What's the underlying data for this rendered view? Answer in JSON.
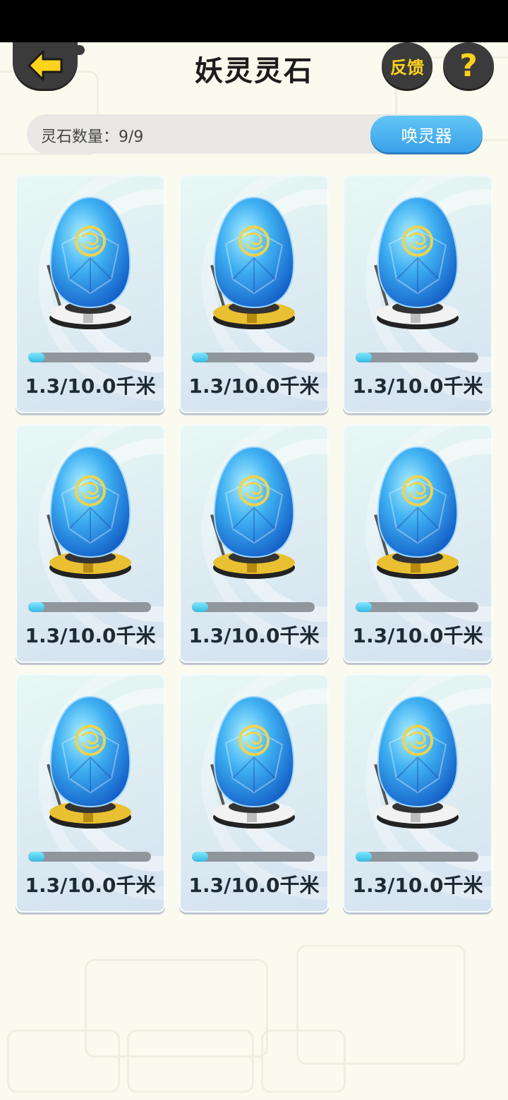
{
  "header": {
    "title": "妖灵灵石",
    "feedback_label": "反馈",
    "help_label": "?"
  },
  "summary": {
    "count_text": "灵石数量：9/9",
    "summon_label": "唤灵器"
  },
  "cards": [
    {
      "distance": "1.3/10.0千米",
      "progress": 0.13,
      "base": "white"
    },
    {
      "distance": "1.3/10.0千米",
      "progress": 0.13,
      "base": "gold"
    },
    {
      "distance": "1.3/10.0千米",
      "progress": 0.13,
      "base": "white"
    },
    {
      "distance": "1.3/10.0千米",
      "progress": 0.13,
      "base": "gold"
    },
    {
      "distance": "1.3/10.0千米",
      "progress": 0.13,
      "base": "gold"
    },
    {
      "distance": "1.3/10.0千米",
      "progress": 0.13,
      "base": "gold"
    },
    {
      "distance": "1.3/10.0千米",
      "progress": 0.13,
      "base": "gold"
    },
    {
      "distance": "1.3/10.0千米",
      "progress": 0.13,
      "base": "white"
    },
    {
      "distance": "1.3/10.0千米",
      "progress": 0.13,
      "base": "white"
    }
  ],
  "icons": {
    "back": "arrow-left-icon",
    "help": "question-icon",
    "stone": "spirit-stone-icon"
  },
  "colors": {
    "accent_yellow": "#ffd21c",
    "button_blue": "#3aa0ea",
    "progress_fill": "#39b9e0"
  }
}
